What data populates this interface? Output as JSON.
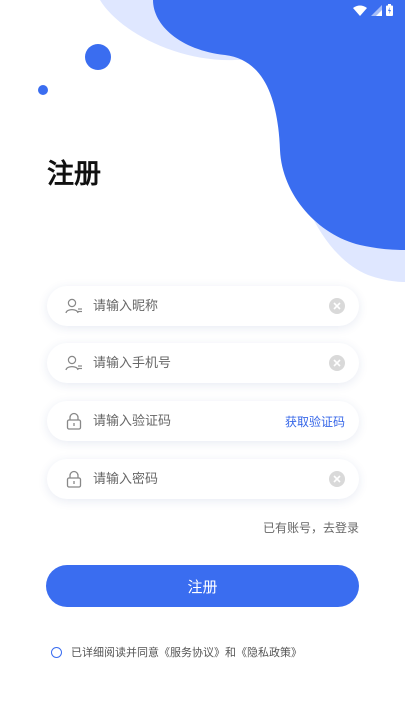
{
  "status_bar": {
    "wifi": "wifi-icon",
    "signal": "signal-icon",
    "battery": "battery-icon"
  },
  "title": "注册",
  "fields": {
    "nickname": {
      "placeholder": "请输入昵称",
      "icon": "user-icon"
    },
    "phone": {
      "placeholder": "请输入手机号",
      "icon": "user-icon"
    },
    "code": {
      "placeholder": "请输入验证码",
      "icon": "lock-icon",
      "action_label": "获取验证码"
    },
    "password": {
      "placeholder": "请输入密码",
      "icon": "lock-icon"
    }
  },
  "login_link": "已有账号，去登录",
  "submit_label": "注册",
  "agreement_text": "已详细阅读并同意《服务协议》和《隐私政策》",
  "colors": {
    "primary": "#3a6df0",
    "primary_light": "#dfe7ff",
    "link": "#3566e8"
  }
}
